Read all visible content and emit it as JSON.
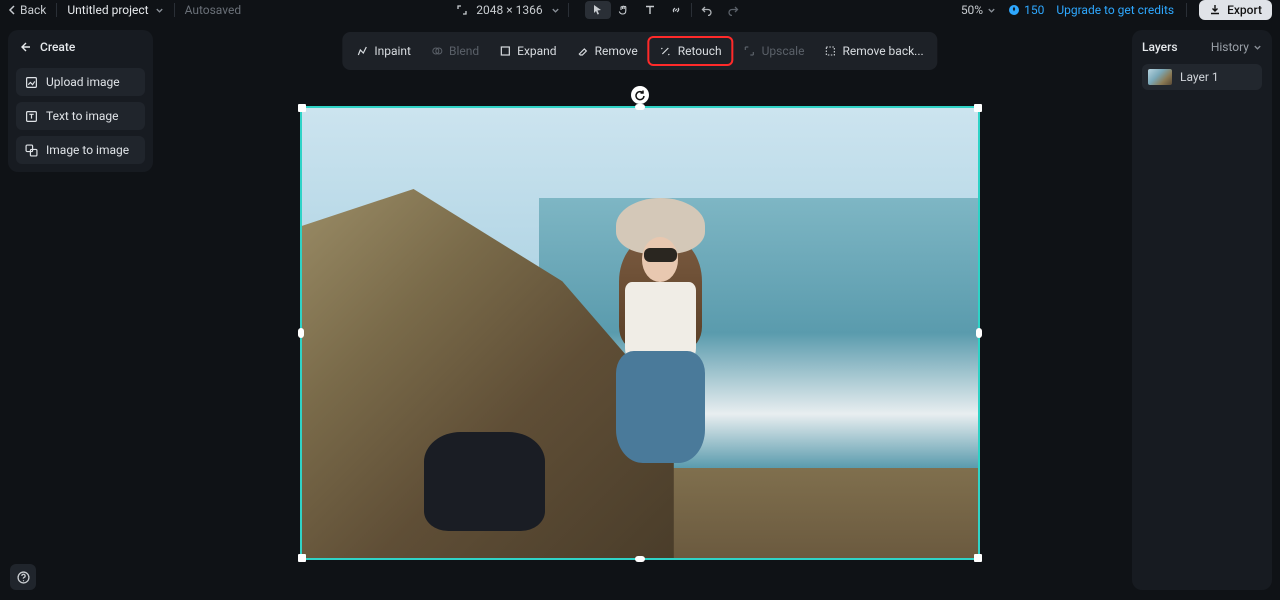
{
  "header": {
    "back": "Back",
    "project_name": "Untitled project",
    "autosaved": "Autosaved",
    "dimensions": "2048 × 1366",
    "zoom": "50%",
    "credits": "150",
    "upgrade": "Upgrade to get credits",
    "export": "Export"
  },
  "left": {
    "create": "Create",
    "upload": "Upload image",
    "text2img": "Text to image",
    "img2img": "Image to image"
  },
  "toolbar": {
    "inpaint": "Inpaint",
    "blend": "Blend",
    "expand": "Expand",
    "remove": "Remove",
    "retouch": "Retouch",
    "upscale": "Upscale",
    "removebg": "Remove back..."
  },
  "right": {
    "layers": "Layers",
    "history": "History",
    "layer1": "Layer 1"
  }
}
